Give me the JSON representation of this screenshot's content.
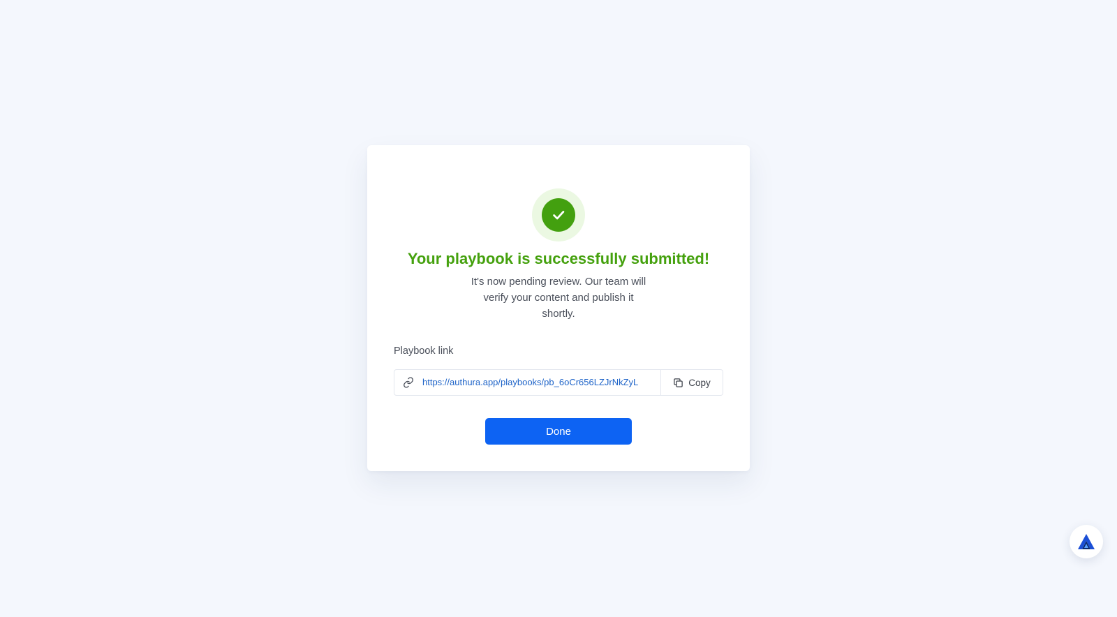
{
  "dialog": {
    "title": "Your playbook is successfully submitted!",
    "message": "It's now pending review. Our team will verify your content and publish it shortly.",
    "link_label": "Playbook link",
    "link_url": "https://authura.app/playbooks/pb_6oCr656LZJrNkZyL",
    "copy_label": "Copy",
    "done_label": "Done",
    "success_icon": "check-circle-icon",
    "link_icon": "link-icon",
    "copy_icon": "copy-icon"
  },
  "launcher": {
    "icon": "authura-logo-icon"
  },
  "colors": {
    "background": "#f4f7fd",
    "success": "#45a10e",
    "success_halo": "#ebf8e2",
    "link": "#1d63c8",
    "primary": "#0d63f3"
  }
}
